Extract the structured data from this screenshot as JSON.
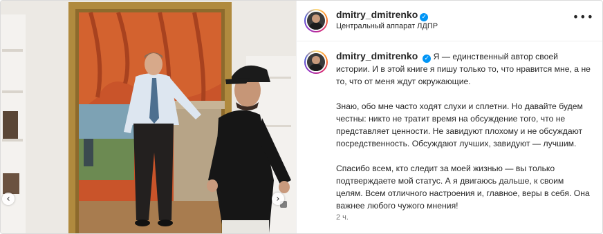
{
  "post": {
    "username": "dmitry_dmitrenko",
    "location": "Центральный аппарат ЛДПР",
    "caption_lead": "Я — единственный автор своей истории. И в этой книге я пишу только то, что нравится мне, а не то, что от меня ждут окружающие.",
    "caption_p2": "Знаю, обо мне часто ходят слухи и сплетни. Но давайте будем честны: никто не тратит время на обсуждение того, что не представляет ценности. Не завидуют плохому и не обсуждают посредственность. Обсуждают лучших, завидуют — лучшим.",
    "caption_p3": "Спасибо всем, кто следит за моей жизнью — вы только подтверждаете мой статус. А я двигаюсь дальше, к своим целям. Всем отличного настроения и, главное, веры в себя. Она важнее любого чужого мнения!",
    "timestamp": "2 ч."
  },
  "icons": {
    "verified": "verified-badge-icon",
    "more": "more-options-icon",
    "prev": "chevron-left-icon",
    "next": "chevron-right-icon"
  },
  "glyphs": {
    "verified": "✓",
    "more": "•••",
    "prev": "‹",
    "next": "›"
  },
  "colors": {
    "accent": "#0095f6",
    "text": "#262626",
    "secondary": "#737373"
  }
}
